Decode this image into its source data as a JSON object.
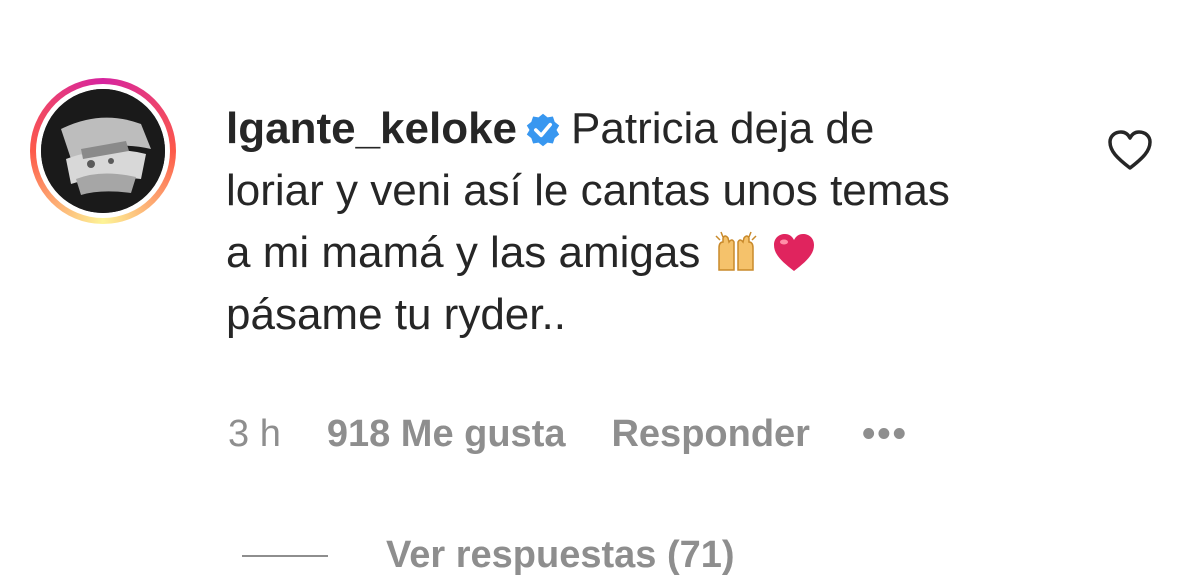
{
  "comment": {
    "username": "lgante_keloke",
    "verified_icon": "verified-badge-icon",
    "text_line1": "Patricia deja de",
    "text_line2": "loriar y veni así le cantas unos temas",
    "text_line3": "a mi mamá y las amigas",
    "text_line4": "pásame tu ryder..",
    "emojis": [
      "raising-hands-icon",
      "red-heart-icon"
    ],
    "like_icon": "heart-outline-icon"
  },
  "meta": {
    "time": "3 h",
    "likes": "918 Me gusta",
    "reply_label": "Responder",
    "more_label": "•••"
  },
  "replies": {
    "label": "Ver respuestas (71)"
  },
  "colors": {
    "text": "#262626",
    "secondary": "#8e8e8e",
    "verified_blue": "#3897f0",
    "heart_red": "#e0245e"
  }
}
